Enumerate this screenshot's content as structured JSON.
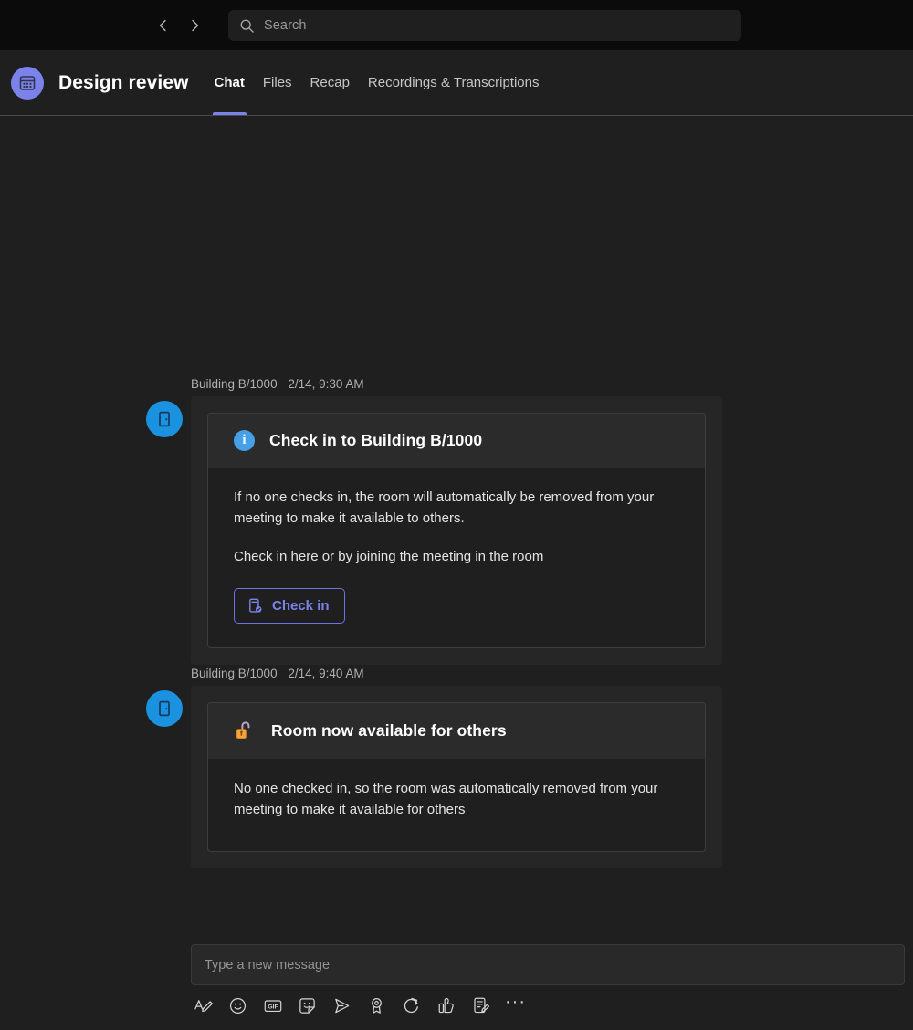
{
  "titlebar": {
    "back_label": "Back",
    "forward_label": "Forward",
    "search": {
      "placeholder": "Search",
      "value": "",
      "icon": "search-icon"
    }
  },
  "meeting_header": {
    "avatar_icon": "calendar-icon",
    "title": "Design review",
    "tabs": [
      {
        "label": "Chat",
        "active": true
      },
      {
        "label": "Files",
        "active": false
      },
      {
        "label": "Recap",
        "active": false
      },
      {
        "label": "Recordings & Transcriptions",
        "active": false
      }
    ]
  },
  "messages": [
    {
      "sender": "Building B/1000",
      "timestamp": "2/14, 9:30 AM",
      "avatar_icon": "door-icon",
      "card": {
        "header_icon": "info-icon",
        "header_title": "Check in to Building B/1000",
        "paragraphs": [
          "If no one checks in, the room will automatically be removed from your meeting to make it available to others.",
          "Check in here or by joining the meeting in the room"
        ],
        "button": {
          "label": "Check in",
          "icon": "device-checkin-icon"
        }
      }
    },
    {
      "sender": "Building B/1000",
      "timestamp": "2/14, 9:40 AM",
      "avatar_icon": "door-icon",
      "card": {
        "header_icon": "unlock-icon",
        "header_title": "Room now available for others",
        "paragraphs": [
          "No one checked in, so the room was automatically removed from your meeting to make it available for others"
        ]
      }
    }
  ],
  "compose": {
    "placeholder": "Type a new message",
    "value": "",
    "toolbar": [
      {
        "icon": "format-text-icon",
        "label": "Format"
      },
      {
        "icon": "emoji-icon",
        "label": "Emoji"
      },
      {
        "icon": "gif-icon",
        "label": "Giphy"
      },
      {
        "icon": "sticker-icon",
        "label": "Sticker"
      },
      {
        "icon": "send-options-icon",
        "label": "Set delivery options"
      },
      {
        "icon": "praise-icon",
        "label": "Praise"
      },
      {
        "icon": "loop-icon",
        "label": "Loop component"
      },
      {
        "icon": "approvals-icon",
        "label": "Approvals"
      },
      {
        "icon": "forms-icon",
        "label": "Forms"
      },
      {
        "icon": "more-options-icon",
        "label": "More options"
      }
    ]
  },
  "colors": {
    "app_background": "#000000",
    "titlebar": "#0b0b0b",
    "surface": "#1f1f1f",
    "bubble": "#262626",
    "card_header": "#2b2b2b",
    "accent_purple": "#7b83eb",
    "accent_blue": "#1a92e0",
    "info_blue": "#46a0e8",
    "unlock_orange": "#f0a030"
  }
}
